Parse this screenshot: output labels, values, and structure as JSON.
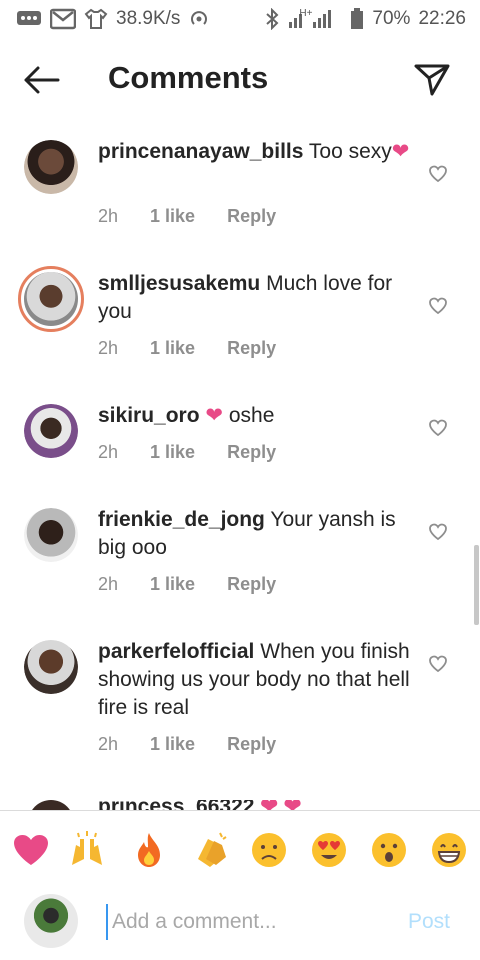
{
  "status_bar": {
    "network_speed": "38.9K/s",
    "network_type": "H+",
    "battery": "70%",
    "time": "22:26"
  },
  "header": {
    "title": "Comments"
  },
  "comments": [
    {
      "username": "princenanayaw_bills",
      "text": "Too sexy",
      "has_heart": true,
      "time": "2h",
      "likes": "1 like",
      "reply": "Reply"
    },
    {
      "username": "smlljesusakemu",
      "text": "Much love for you",
      "has_heart": false,
      "time": "2h",
      "likes": "1 like",
      "reply": "Reply"
    },
    {
      "username": "sikiru_oro",
      "text": "oshe",
      "has_heart": true,
      "time": "2h",
      "likes": "1 like",
      "reply": "Reply"
    },
    {
      "username": "frienkie_de_jong",
      "text": "Your yansh is big ooo",
      "has_heart": false,
      "time": "2h",
      "likes": "1 like",
      "reply": "Reply"
    },
    {
      "username": "parkerfelofficial",
      "text": "When you finish showing us your body no that hell fire is real",
      "has_heart": false,
      "time": "2h",
      "likes": "1 like",
      "reply": "Reply"
    }
  ],
  "partial_comment": {
    "username": "princess_66322"
  },
  "emoji_bar": [
    "heart",
    "raised-hands",
    "fire",
    "clapping-hands",
    "sad-face",
    "heart-eyes",
    "surprised-face",
    "grinning-face"
  ],
  "composer": {
    "placeholder": "Add a comment...",
    "post_label": "Post"
  },
  "colors": {
    "accent_blue": "#3897f0",
    "post_disabled": "#b2dffc",
    "heart_pink": "#e84a87",
    "story_ring": "#e57f5e"
  }
}
